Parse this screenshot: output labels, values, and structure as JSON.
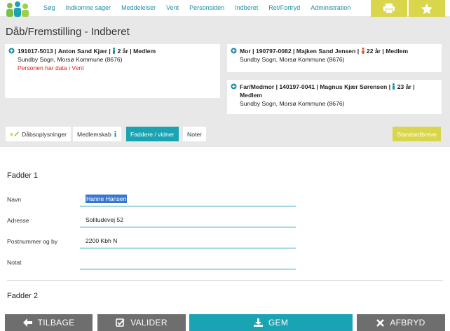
{
  "nav": {
    "items": [
      "Søg",
      "Indkomne sager",
      "Meddelelser",
      "Vent",
      "Personsiden",
      "Indberet",
      "Ret/Fortryd",
      "Administration"
    ]
  },
  "toolbar": {
    "print_icon": "printer-icon",
    "favorite_icon": "star-icon"
  },
  "page": {
    "title": "Dåb/Fremstilling - Indberet"
  },
  "child": {
    "id": "191017-5013",
    "name": "Anton Sand Kjær",
    "age": "2 år",
    "status": "Medlem",
    "location": "Sundby Sogn, Morsø Kommune (8676)",
    "warning": "Personen har data i Vent"
  },
  "mother": {
    "role": "Mor",
    "id": "190797-0082",
    "name": "Majken Sand Jensen",
    "age": "22 år",
    "status": "Medlem",
    "location": "Sundby Sogn, Morsø Kommune (8676)"
  },
  "father": {
    "role": "Far/Medmor",
    "id": "140197-0041",
    "name": "Magnus Kjær Sørensen",
    "age": "23 år",
    "status": "Medlem",
    "location": "Sundby Sogn, Morsø Kommune (8676)"
  },
  "tabs": {
    "daab": "Dåbsoplysninger",
    "medlemskab": "Medlemskab",
    "faddere": "Faddere / vidner",
    "noter": "Noter",
    "standardbreve": "Standardbreve"
  },
  "fadder1": {
    "title": "Fadder 1",
    "labels": {
      "navn": "Navn",
      "adresse": "Adresse",
      "postnummer": "Postnummer og by",
      "notat": "Notat"
    },
    "values": {
      "navn": "Hanne Hansen",
      "adresse": "Solitudevej 52",
      "postnummer": "2200 Kbh N",
      "notat": ""
    }
  },
  "fadder2": {
    "title": "Fadder 2"
  },
  "actions": {
    "back": "TILBAGE",
    "validate": "VALIDER",
    "save": "GEM",
    "cancel": "AFBRYD"
  },
  "colors": {
    "teal": "#1aa3b3",
    "yellow": "#d9d64b",
    "gray_button": "#6e6e6e",
    "warning": "#e02020"
  }
}
